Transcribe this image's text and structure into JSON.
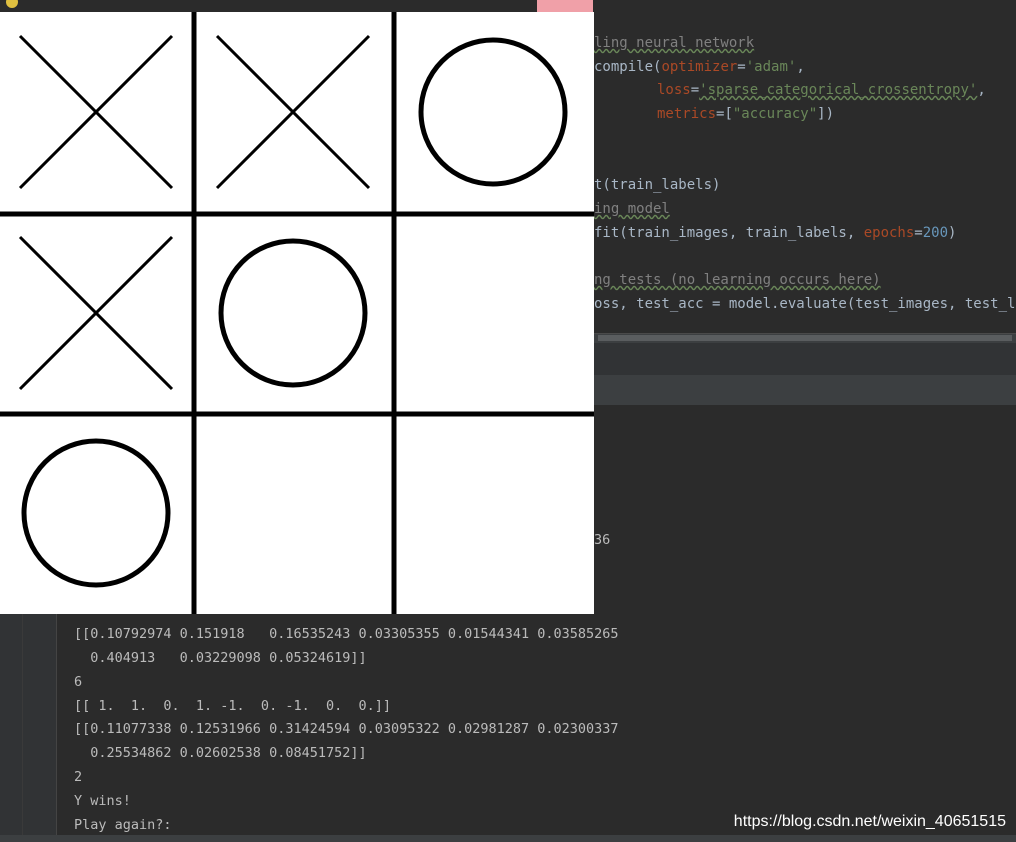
{
  "editor": {
    "lines": [
      {
        "kind": "comment",
        "text": "ling neural network"
      },
      {
        "kind": "compile",
        "text": "compile(",
        "param": "optimizer",
        "eq": "=",
        "str": "'adam'",
        "tail": ","
      },
      {
        "kind": "loss",
        "param": "loss",
        "eq": "=",
        "str": "'sparse_categorical_crossentropy'",
        "tail": ","
      },
      {
        "kind": "metrics",
        "param": "metrics",
        "eq": "=[",
        "str": "\"accuracy\"",
        "tail": "])"
      },
      {
        "kind": "plain",
        "text": "t(train_labels)"
      },
      {
        "kind": "comment",
        "text": "ing model"
      },
      {
        "kind": "fit",
        "text": "fit(train_images, train_labels, ",
        "param": "epochs",
        "eq": "=",
        "num": "200",
        "tail": ")"
      },
      {
        "kind": "comment",
        "text": "ng tests (no learning occurs here)"
      },
      {
        "kind": "plain",
        "text": "oss, test_acc = model.evaluate(test_images, test_labe"
      }
    ]
  },
  "console": {
    "fragment_right": "36",
    "lines": [
      "[[0.10792974 0.151918   0.16535243 0.03305355 0.01544341 0.03585265",
      "  0.404913   0.03229098 0.05324619]]",
      "6",
      "[[ 1.  1.  0.  1. -1.  0. -1.  0.  0.]]",
      "[[0.11077338 0.12531966 0.31424594 0.03095322 0.02981287 0.02300337",
      "  0.25534862 0.02602538 0.08451752]]",
      "2",
      "Y wins!",
      "Play again?:"
    ]
  },
  "game": {
    "board": [
      "X",
      "X",
      "O",
      "X",
      "O",
      "",
      "O",
      "",
      ""
    ],
    "line_color": "#000000",
    "background": "#ffffff"
  },
  "watermark": "https://blog.csdn.net/weixin_40651515",
  "colors": {
    "keyword": "#cc7832",
    "string": "#6a8759",
    "number": "#6897bb",
    "param": "#aa4926"
  }
}
